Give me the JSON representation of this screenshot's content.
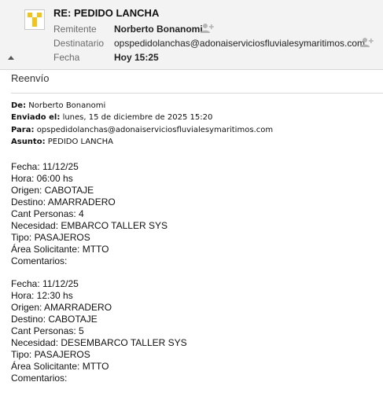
{
  "header": {
    "subject": "RE: PEDIDO LANCHA",
    "from_label": "Remitente",
    "from_value": "Norberto Bonanomi",
    "to_label": "Destinatario",
    "to_value": "opspedidolanchas@adonaiserviciosfluvialesymaritimos.com",
    "date_label": "Fecha",
    "date_value": "Hoy 15:25"
  },
  "reenvio": "Reenvío",
  "meta": {
    "de_label": "De:",
    "de_value": "Norberto Bonanomi",
    "enviado_label": "Enviado el:",
    "enviado_value": "lunes, 15 de diciembre de 2025 15:20",
    "para_label": "Para:",
    "para_value": "opspedidolanchas@adonaiserviciosfluvialesymaritimos.com",
    "asunto_label": "Asunto:",
    "asunto_value": "PEDIDO LANCHA"
  },
  "block1": [
    "Fecha: 11/12/25",
    "Hora: 06:00 hs",
    "Origen: CABOTAJE",
    "Destino: AMARRADERO",
    "Cant Personas: 4",
    "Necesidad: EMBARCO TALLER SYS",
    "Tipo: PASAJEROS",
    "Área Solicitante: MTTO",
    "Comentarios:"
  ],
  "block2": [
    "Fecha: 11/12/25",
    "Hora: 12:30 hs",
    "Origen: AMARRADERO",
    "Destino: CABOTAJE",
    "Cant Personas: 5",
    "Necesidad: DESEMBARCO TALLER SYS",
    "Tipo: PASAJEROS",
    "Área Solicitante: MTTO",
    "Comentarios:"
  ],
  "colors": {
    "header_bg": "#f3f3f3",
    "logo_yellow": "#f0c419",
    "label_gray": "#6b6b6b"
  },
  "icons": [
    "app-logo-icon",
    "add-contact-icon",
    "collapse-arrow-icon"
  ]
}
